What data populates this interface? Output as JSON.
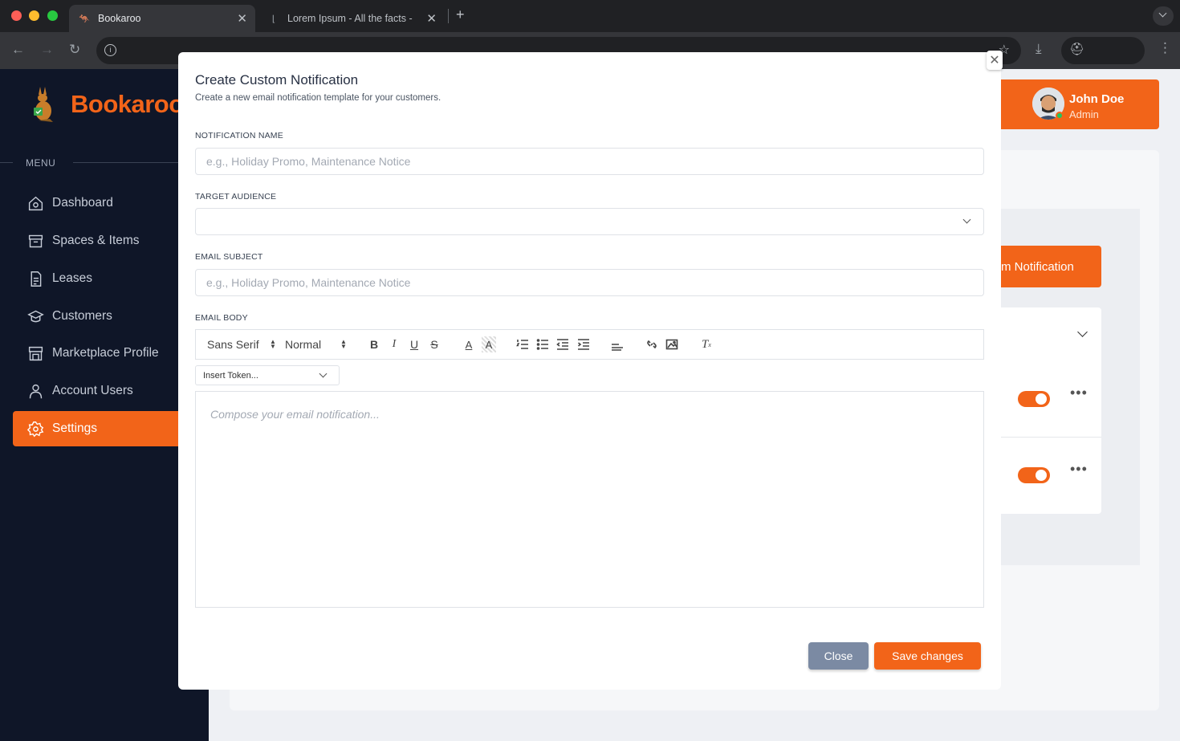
{
  "browser": {
    "tabs": [
      {
        "title": "Bookaroo",
        "active": true
      },
      {
        "title": "Lorem Ipsum - All the facts - ",
        "active": false
      }
    ],
    "new_tab_icon": "plus-icon"
  },
  "sidebar": {
    "brand": "Bookaroo",
    "menu_label": "MENU",
    "items": [
      {
        "label": "Dashboard",
        "icon": "home-icon",
        "active": false
      },
      {
        "label": "Spaces & Items",
        "icon": "archive-icon",
        "active": false
      },
      {
        "label": "Leases",
        "icon": "document-icon",
        "active": false
      },
      {
        "label": "Customers",
        "icon": "graduation-cap-icon",
        "active": false
      },
      {
        "label": "Marketplace Profile",
        "icon": "store-icon",
        "active": false
      },
      {
        "label": "Account Users",
        "icon": "user-icon",
        "active": false
      },
      {
        "label": "Settings",
        "icon": "gear-icon",
        "active": true
      }
    ]
  },
  "header": {
    "user_name": "John Doe",
    "user_role": "Admin"
  },
  "background": {
    "create_button_partial": "m Notification"
  },
  "modal": {
    "title": "Create Custom Notification",
    "subtitle": "Create a new email notification template for your customers.",
    "fields": {
      "name_label": "NOTIFICATION NAME",
      "name_placeholder": "e.g., Holiday Promo, Maintenance Notice",
      "audience_label": "TARGET AUDIENCE",
      "audience_value": "",
      "subject_label": "EMAIL SUBJECT",
      "subject_placeholder": "e.g., Holiday Promo, Maintenance Notice",
      "body_label": "EMAIL BODY"
    },
    "toolbar": {
      "font": "Sans Serif",
      "size": "Normal"
    },
    "token_select": "Insert Token...",
    "editor_placeholder": "Compose your email notification...",
    "close_label": "Close",
    "save_label": "Save changes"
  },
  "colors": {
    "accent": "#f26419",
    "sidebar_bg": "#0f1628",
    "close_button": "#7b8aa3"
  }
}
